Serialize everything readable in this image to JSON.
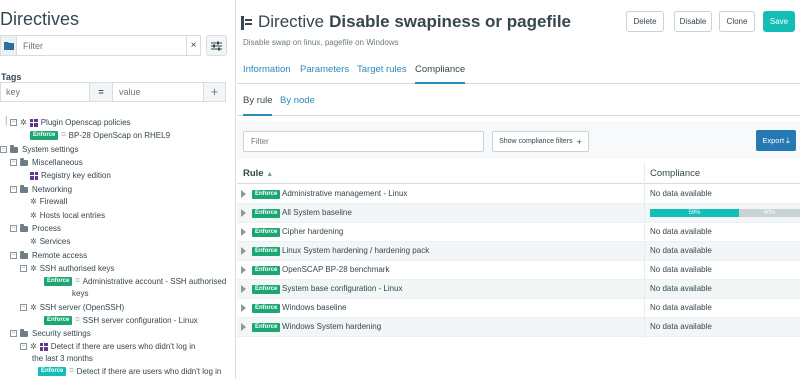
{
  "left": {
    "title": "Directives",
    "filter_placeholder": "Filter",
    "tags_label": "Tags",
    "tag_key_placeholder": "key",
    "tag_equals": "=",
    "tag_value_placeholder": "value",
    "add_tag": "+",
    "clear": "×",
    "tree": {
      "plugin_openscap": "Plugin Openscap policies",
      "bp28_rhel9": "BP-28 OpenScap on RHEL9",
      "system_settings": "System settings",
      "miscellaneous": "Miscellaneous",
      "registry_key": "Registry key edition",
      "networking": "Networking",
      "firewall": "Firewall",
      "hosts_local": "Hosts local entries",
      "process": "Process",
      "services": "Services",
      "remote_access": "Remote access",
      "ssh_keys": "SSH authorised keys",
      "admin_account": "Administrative account - SSH authorised",
      "admin_account_2": "keys",
      "ssh_server": "SSH server (OpenSSH)",
      "ssh_server_config": "SSH server configuration - Linux",
      "security_settings": "Security settings",
      "detect_users": "Detect if there are users who didn't log in",
      "detect_users_2": "the last 3 months",
      "detect_users_child": "Detect if there are users who didn't log in",
      "enforce": "Enforce"
    }
  },
  "header": {
    "title_prefix": "Directive",
    "title_name": "Disable swapiness or pagefile",
    "description": "Disable swap on linux, pagefile on Windows",
    "buttons": {
      "delete": "Delete",
      "disable": "Disable",
      "clone": "Clone",
      "save": "Save"
    }
  },
  "tabs": [
    "Information",
    "Parameters",
    "Target rules",
    "Compliance"
  ],
  "subtabs": [
    "By rule",
    "By node"
  ],
  "compliance": {
    "filter_placeholder": "Filter",
    "show_filters": "Show compliance filters",
    "export": "Export",
    "col_rule": "Rule",
    "col_compliance": "Compliance",
    "rows": [
      {
        "badge": "Enforce",
        "rule": "Administrative management - Linux",
        "compliance": "No data available"
      },
      {
        "badge": "Enforce",
        "rule": "All System baseline",
        "compliance_bar": {
          "success": 59,
          "no_data": 40
        },
        "success_label": "59%",
        "no_data_label": "40%"
      },
      {
        "badge": "Enforce",
        "rule": "Cipher hardening",
        "compliance": "No data available"
      },
      {
        "badge": "Enforce",
        "rule": "Linux System hardening / hardening pack",
        "compliance": "No data available"
      },
      {
        "badge": "Enforce",
        "rule": "OpenSCAP BP-28 benchmark",
        "compliance": "No data available"
      },
      {
        "badge": "Enforce",
        "rule": "System base configuration - Linux",
        "compliance": "No data available"
      },
      {
        "badge": "Enforce",
        "rule": "Windows baseline",
        "compliance": "No data available"
      },
      {
        "badge": "Enforce",
        "rule": "Windows System hardening",
        "compliance": "No data available"
      }
    ]
  },
  "colors": {
    "accent": "#13beb7",
    "link": "#2b8ab8",
    "export": "#2679b3",
    "enforce": "#1ba672"
  }
}
